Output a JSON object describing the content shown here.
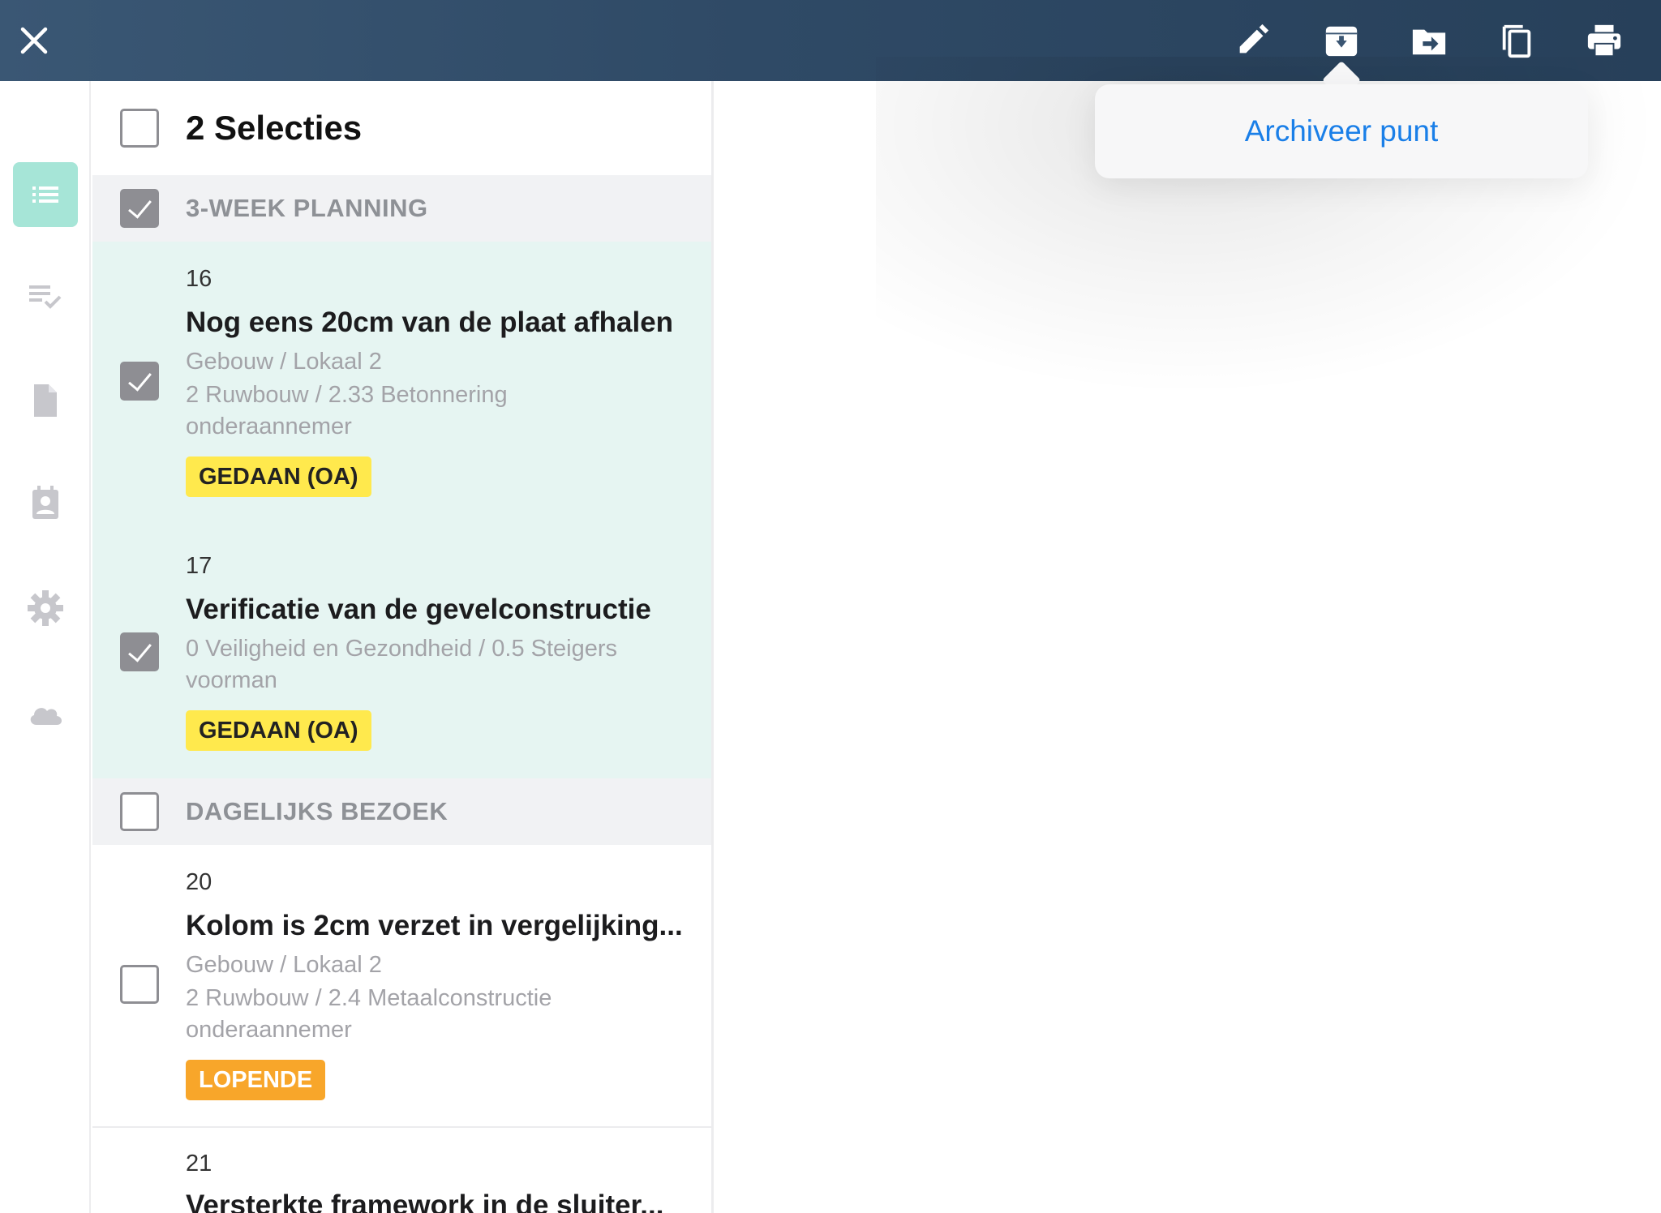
{
  "toolbar": {
    "icons": [
      "close-icon",
      "edit-icon",
      "archive-icon",
      "move-icon",
      "copy-icon",
      "print-icon"
    ]
  },
  "popover": {
    "label": "Archiveer punt"
  },
  "sidebar": {
    "items": [
      "list-icon",
      "checklist-icon",
      "document-icon",
      "contacts-icon",
      "settings-icon",
      "cloud-icon"
    ],
    "active_color": "#a6e5d7"
  },
  "selection": {
    "title": "2 Selecties"
  },
  "sections": [
    {
      "label": "3-WEEK PLANNING",
      "items": [
        {
          "number": "16",
          "title": "Nog eens 20cm van de plaat afhalen",
          "lines": [
            "Gebouw / Lokaal 2",
            "2 Ruwbouw / 2.33 Betonnering",
            "onderaannemer"
          ],
          "status": "GEDAAN (OA)"
        },
        {
          "number": "17",
          "title": "Verificatie van de gevelconstructie",
          "lines": [
            "0 Veiligheid en Gezondheid / 0.5 Steigers",
            "voorman"
          ],
          "status": "GEDAAN (OA)"
        }
      ]
    },
    {
      "label": "DAGELIJKS BEZOEK",
      "items": [
        {
          "number": "20",
          "title": "Kolom is 2cm verzet in vergelijking...",
          "lines": [
            "Gebouw / Lokaal 2",
            "2 Ruwbouw / 2.4 Metaalconstructie",
            "onderaannemer"
          ],
          "status": "LOPENDE"
        },
        {
          "number": "21",
          "title": "Versterkte framework in de sluiter..."
        }
      ]
    }
  ],
  "colors": {
    "topbar": "#2f4a66",
    "selected_row": "#e6f5f2",
    "badge_done": "#ffe94d",
    "badge_running": "#f8a62a",
    "link": "#1a7fe8"
  }
}
